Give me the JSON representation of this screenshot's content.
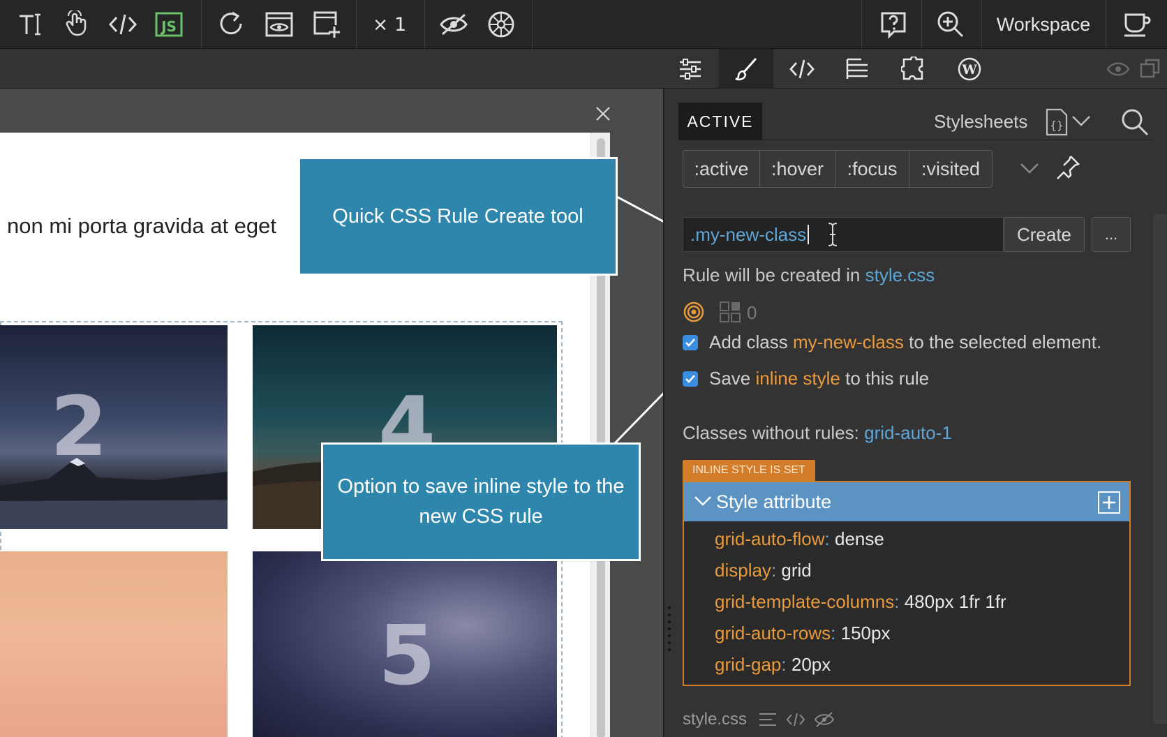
{
  "toolbar": {
    "speed": "× 1",
    "workspace_label": "Workspace"
  },
  "canvas": {
    "lorem_text": "non mi porta gravida at eget",
    "tiles": [
      {
        "number": "2"
      },
      {
        "number": "4"
      },
      {
        "number": ""
      },
      {
        "number": "5"
      }
    ]
  },
  "callouts": {
    "quick_css": "Quick CSS Rule Create tool",
    "inline_option": "Option to save inline style to the new CSS rule"
  },
  "panel": {
    "tab_active": "ACTIVE",
    "stylesheets_label": "Stylesheets",
    "pseudo_classes": [
      ":active",
      ":hover",
      ":focus",
      ":visited"
    ],
    "rule_input_value": ".my-new-class",
    "create_label": "Create",
    "more_label": "...",
    "created_in_prefix": "Rule will be created in",
    "created_in_file": "style.css",
    "selector_count": "0",
    "add_class": {
      "prefix": "Add class",
      "class_name": "my-new-class",
      "suffix": "to the selected element."
    },
    "save_inline": {
      "prefix": "Save",
      "highlight": "inline style",
      "suffix": "to this rule"
    },
    "classes_without_rules_label": "Classes without rules:",
    "classes_without_rules_value": "grid-auto-1",
    "inline_badge": "INLINE STYLE IS SET",
    "style_attribute_title": "Style attribute",
    "properties": [
      {
        "name": "grid-auto-flow",
        "value": "dense"
      },
      {
        "name": "display",
        "value": "grid"
      },
      {
        "name": "grid-template-columns",
        "value": "480px 1fr 1fr"
      },
      {
        "name": "grid-auto-rows",
        "value": "150px"
      },
      {
        "name": "grid-gap",
        "value": "20px"
      }
    ],
    "footer_file": "style.css"
  },
  "colors": {
    "accent_blue": "#2e86ad",
    "orange": "#d37c2a",
    "js_green": "#6cc26c"
  }
}
